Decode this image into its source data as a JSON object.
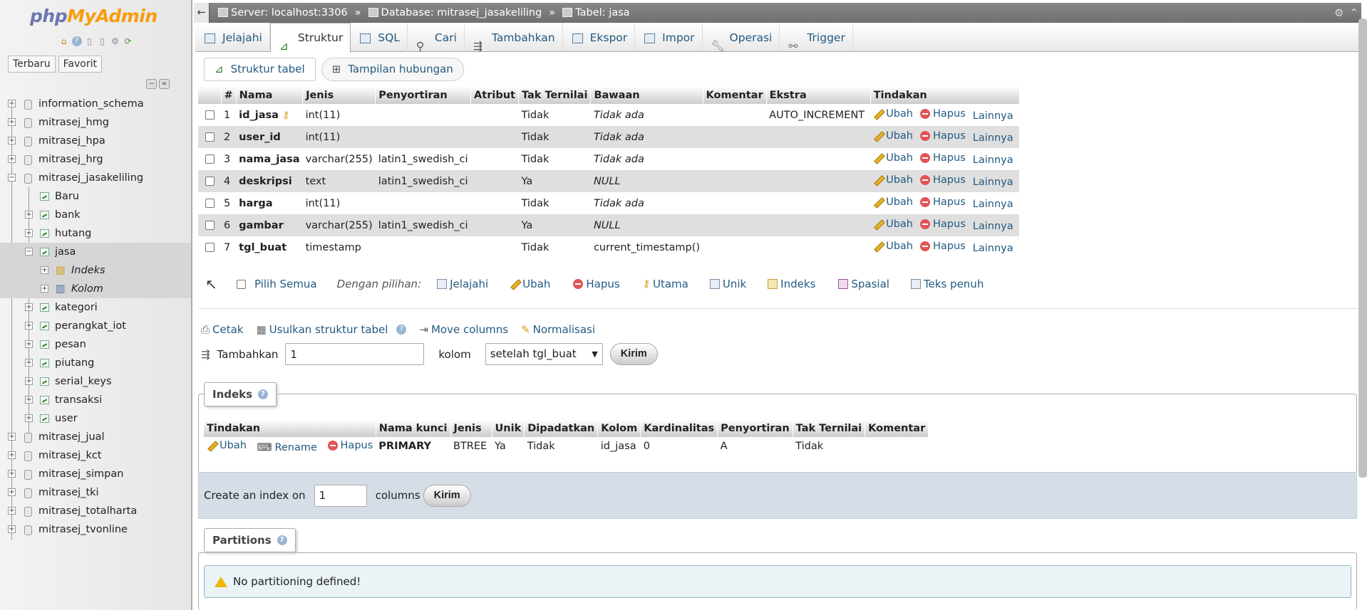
{
  "logo": {
    "part1": "php",
    "part2": "MyAdmin"
  },
  "sidebar": {
    "tabs": [
      "Terbaru",
      "Favorit"
    ],
    "databases": [
      {
        "name": "information_schema",
        "expanded": false
      },
      {
        "name": "mitrasej_hmg",
        "expanded": false
      },
      {
        "name": "mitrasej_hpa",
        "expanded": false
      },
      {
        "name": "mitrasej_hrg",
        "expanded": false
      },
      {
        "name": "mitrasej_jasakeliling",
        "expanded": true
      }
    ],
    "new_item": "Baru",
    "tables": [
      "bank",
      "hutang",
      "jasa",
      "kategori",
      "perangkat_iot",
      "pesan",
      "piutang",
      "serial_keys",
      "transaksi",
      "user"
    ],
    "jasa_children": [
      "Indeks",
      "Kolom"
    ],
    "databases_after": [
      "mitrasej_jual",
      "mitrasej_kct",
      "mitrasej_simpan",
      "mitrasej_tki",
      "mitrasej_totalharta",
      "mitrasej_tvonline"
    ]
  },
  "breadcrumb": {
    "back": "←",
    "server": "Server: localhost:3306",
    "sep": "»",
    "database": "Database: mitrasej_jasakeliling",
    "table": "Tabel: jasa",
    "settings_icon": "⚙",
    "collapse_icon": "⌃"
  },
  "tabs": [
    "Jelajahi",
    "Struktur",
    "SQL",
    "Cari",
    "Tambahkan",
    "Ekspor",
    "Impor",
    "Operasi",
    "Trigger"
  ],
  "active_tab": "Struktur",
  "subtabs": [
    "Struktur tabel",
    "Tampilan hubungan"
  ],
  "structure": {
    "headers": [
      "#",
      "Nama",
      "Jenis",
      "Penyortiran",
      "Atribut",
      "Tak Ternilai",
      "Bawaan",
      "Komentar",
      "Ekstra",
      "Tindakan"
    ],
    "rows": [
      {
        "num": "1",
        "name": "id_jasa",
        "key": true,
        "type": "int(11)",
        "collation": "",
        "attributes": "",
        "null": "Tidak",
        "default": "Tidak ada",
        "default_italic": true,
        "comment": "",
        "extra": "AUTO_INCREMENT"
      },
      {
        "num": "2",
        "name": "user_id",
        "key": false,
        "type": "int(11)",
        "collation": "",
        "attributes": "",
        "null": "Tidak",
        "default": "Tidak ada",
        "default_italic": true,
        "comment": "",
        "extra": ""
      },
      {
        "num": "3",
        "name": "nama_jasa",
        "key": false,
        "type": "varchar(255)",
        "collation": "latin1_swedish_ci",
        "attributes": "",
        "null": "Tidak",
        "default": "Tidak ada",
        "default_italic": true,
        "comment": "",
        "extra": ""
      },
      {
        "num": "4",
        "name": "deskripsi",
        "key": false,
        "type": "text",
        "collation": "latin1_swedish_ci",
        "attributes": "",
        "null": "Ya",
        "default": "NULL",
        "default_italic": true,
        "comment": "",
        "extra": ""
      },
      {
        "num": "5",
        "name": "harga",
        "key": false,
        "type": "int(11)",
        "collation": "",
        "attributes": "",
        "null": "Tidak",
        "default": "Tidak ada",
        "default_italic": true,
        "comment": "",
        "extra": ""
      },
      {
        "num": "6",
        "name": "gambar",
        "key": false,
        "type": "varchar(255)",
        "collation": "latin1_swedish_ci",
        "attributes": "",
        "null": "Ya",
        "default": "NULL",
        "default_italic": true,
        "comment": "",
        "extra": ""
      },
      {
        "num": "7",
        "name": "tgl_buat",
        "key": false,
        "type": "timestamp",
        "collation": "",
        "attributes": "",
        "null": "Tidak",
        "default": "current_timestamp()",
        "default_italic": false,
        "comment": "",
        "extra": ""
      }
    ],
    "row_actions": [
      "Ubah",
      "Hapus",
      "Lainnya"
    ]
  },
  "with_selected": {
    "arrow": "↖",
    "check_all": "Pilih Semua",
    "label": "Dengan pilihan:",
    "actions": [
      "Jelajahi",
      "Ubah",
      "Hapus",
      "Utama",
      "Unik",
      "Indeks",
      "Spasial",
      "Teks penuh"
    ]
  },
  "tools": [
    "Cetak",
    "Usulkan struktur tabel",
    "Move columns",
    "Normalisasi"
  ],
  "add_columns": {
    "label": "Tambahkan",
    "value": "1",
    "unit": "kolom",
    "position": "setelah tgl_buat",
    "submit": "Kirim"
  },
  "indexes": {
    "legend": "Indeks",
    "headers": [
      "Tindakan",
      "Nama kunci",
      "Jenis",
      "Unik",
      "Dipadatkan",
      "Kolom",
      "Kardinalitas",
      "Penyortiran",
      "Tak Ternilai",
      "Komentar"
    ],
    "row": {
      "actions": [
        "Ubah",
        "Rename",
        "Hapus"
      ],
      "key_name": "PRIMARY",
      "type": "BTREE",
      "unique": "Ya",
      "packed": "Tidak",
      "column": "id_jasa",
      "cardinality": "0",
      "collation": "A",
      "null": "Tidak",
      "comment": ""
    }
  },
  "create_index": {
    "label": "Create an index on",
    "value": "1",
    "unit": "columns",
    "submit": "Kirim"
  },
  "partitions": {
    "legend": "Partitions",
    "message": "No partitioning defined!"
  }
}
